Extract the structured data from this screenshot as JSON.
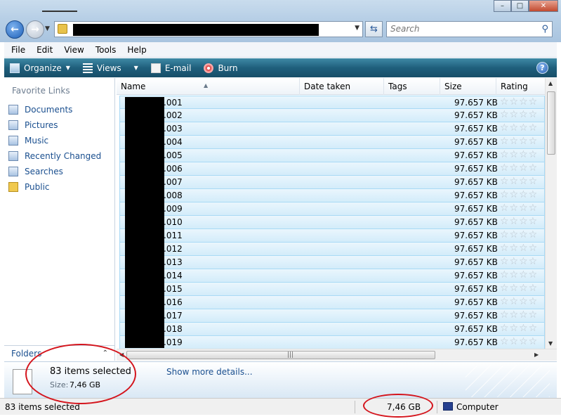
{
  "window": {
    "minimize_label": "–",
    "maximize_label": "□",
    "close_label": "✕"
  },
  "address_bar": {
    "search_placeholder": "Search"
  },
  "menu": [
    "File",
    "Edit",
    "View",
    "Tools",
    "Help"
  ],
  "commands": {
    "organize": "Organize",
    "views": "Views",
    "email": "E-mail",
    "burn": "Burn",
    "help": "?"
  },
  "navigation": {
    "heading": "Favorite Links",
    "items": [
      "Documents",
      "Pictures",
      "Music",
      "Recently Changed",
      "Searches",
      "Public"
    ],
    "folders_label": "Folders"
  },
  "columns": [
    "Name",
    "Date taken",
    "Tags",
    "Size",
    "Rating"
  ],
  "files": [
    {
      "name": ".001",
      "size": "97.657 KB"
    },
    {
      "name": ".002",
      "size": "97.657 KB"
    },
    {
      "name": ".003",
      "size": "97.657 KB"
    },
    {
      "name": ".004",
      "size": "97.657 KB"
    },
    {
      "name": ".005",
      "size": "97.657 KB"
    },
    {
      "name": ".006",
      "size": "97.657 KB"
    },
    {
      "name": ".007",
      "size": "97.657 KB"
    },
    {
      "name": ".008",
      "size": "97.657 KB"
    },
    {
      "name": ".009",
      "size": "97.657 KB"
    },
    {
      "name": ".010",
      "size": "97.657 KB"
    },
    {
      "name": ".011",
      "size": "97.657 KB"
    },
    {
      "name": ".012",
      "size": "97.657 KB"
    },
    {
      "name": ".013",
      "size": "97.657 KB"
    },
    {
      "name": ".014",
      "size": "97.657 KB"
    },
    {
      "name": ".015",
      "size": "97.657 KB"
    },
    {
      "name": ".016",
      "size": "97.657 KB"
    },
    {
      "name": ".017",
      "size": "97.657 KB"
    },
    {
      "name": ".018",
      "size": "97.657 KB"
    },
    {
      "name": ".019",
      "size": "97.657 KB"
    }
  ],
  "rating_stars": "☆☆☆☆",
  "details": {
    "title": "83 items selected",
    "size_label": "Size:",
    "size_value": "7,46 GB",
    "show_more": "Show more details..."
  },
  "status": {
    "selected": "83 items selected",
    "total_size": "7,46 GB",
    "location": "Computer"
  },
  "colors": {
    "annotation": "#d4141c",
    "selection": "#d3ecfa",
    "link": "#1a4f8f"
  }
}
